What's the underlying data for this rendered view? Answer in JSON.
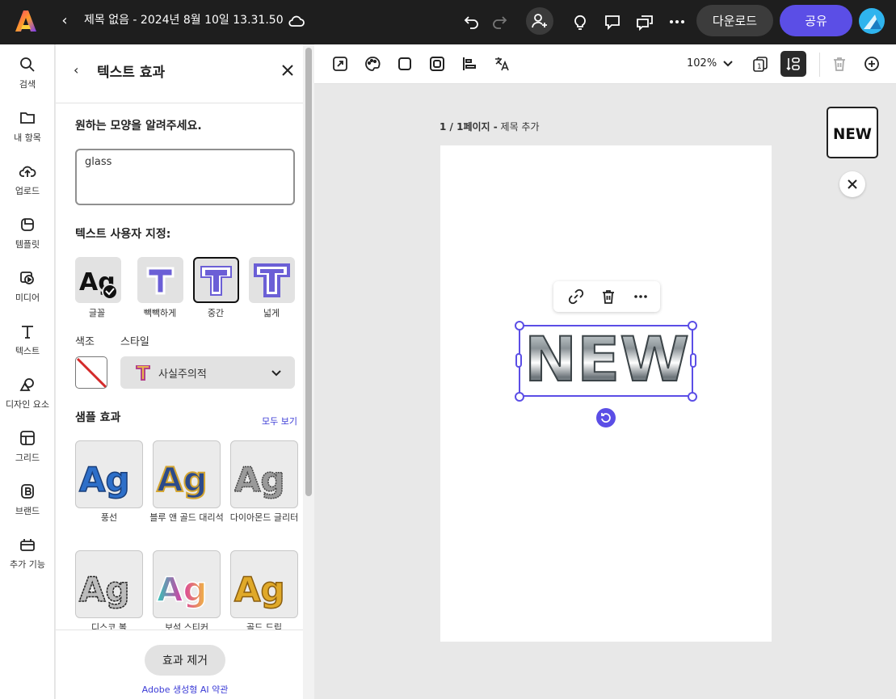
{
  "document": {
    "title": "제목 없음 - 2024년 8월 10일 13.31.50"
  },
  "topbar": {
    "download_label": "다운로드",
    "share_label": "공유"
  },
  "leftnav": {
    "items": [
      {
        "label": "검색",
        "icon": "search-icon"
      },
      {
        "label": "내 항목",
        "icon": "folder-icon"
      },
      {
        "label": "업로드",
        "icon": "upload-cloud-icon"
      },
      {
        "label": "템플릿",
        "icon": "template-icon"
      },
      {
        "label": "미디어",
        "icon": "media-icon"
      },
      {
        "label": "텍스트",
        "icon": "text-icon"
      },
      {
        "label": "디자인 요소",
        "icon": "shapes-icon"
      },
      {
        "label": "그리드",
        "icon": "grid-icon"
      },
      {
        "label": "브랜드",
        "icon": "brand-icon"
      },
      {
        "label": "추가 기능",
        "icon": "add-ons-icon"
      }
    ]
  },
  "panel": {
    "title": "텍스트 효과",
    "prompt_label": "원하는 모양을 알려주세요.",
    "prompt_value": "glass",
    "customize_label": "텍스트 사용자 지정:",
    "shapes": [
      {
        "label": "글꼴",
        "selected": false
      },
      {
        "label": "빽빽하게",
        "selected": false
      },
      {
        "label": "중간",
        "selected": true
      },
      {
        "label": "넓게",
        "selected": false
      }
    ],
    "color_label": "색조",
    "style_label": "스타일",
    "style_value": "사실주의적",
    "samples_label": "샘플 효과",
    "see_all": "모두 보기",
    "samples": [
      {
        "label": "풍선"
      },
      {
        "label": "블루 앤 골드 대리석"
      },
      {
        "label": "다이아몬드 글리터"
      },
      {
        "label": "디스코 볼"
      },
      {
        "label": "보석 스티커"
      },
      {
        "label": "골드 드립"
      }
    ],
    "sample_glyph": "Ag",
    "remove_button": "효과 제거",
    "terms_link": "Adobe 생성형 AI 약관"
  },
  "canvas": {
    "zoom": "102%",
    "page_label_bold": "1 / 1페이지 -",
    "page_label_rest": " 제목 추가",
    "text_content": "NEW",
    "accent": "#5b4ee6"
  }
}
